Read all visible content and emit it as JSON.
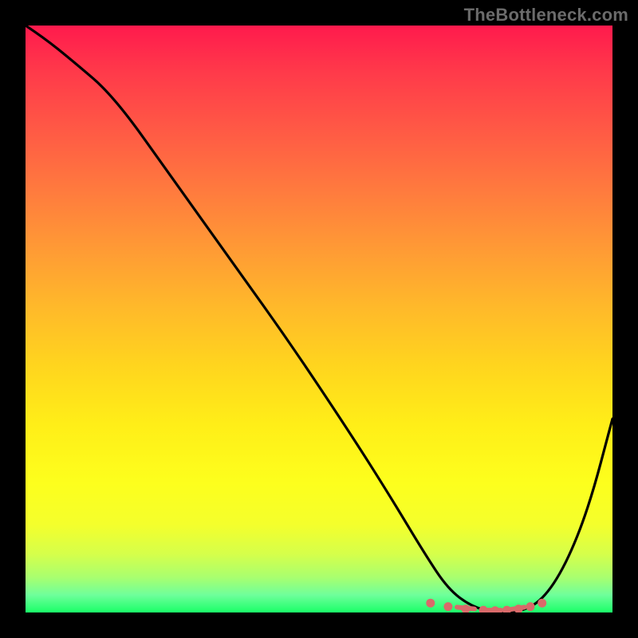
{
  "watermark": "TheBottleneck.com",
  "chart_data": {
    "type": "line",
    "title": "",
    "xlabel": "",
    "ylabel": "",
    "xlim": [
      0,
      100
    ],
    "ylim": [
      0,
      100
    ],
    "grid": false,
    "legend": false,
    "gradient_background": {
      "direction": "vertical",
      "stops": [
        {
          "pos": 0,
          "color": "#ff1a4d"
        },
        {
          "pos": 18,
          "color": "#ff5a45"
        },
        {
          "pos": 38,
          "color": "#ff9a35"
        },
        {
          "pos": 58,
          "color": "#ffd51e"
        },
        {
          "pos": 78,
          "color": "#fdff1d"
        },
        {
          "pos": 94,
          "color": "#a9ff6f"
        },
        {
          "pos": 100,
          "color": "#1aff68"
        }
      ]
    },
    "series": [
      {
        "name": "curve",
        "color": "#000000",
        "x": [
          0,
          3,
          8,
          15,
          25,
          35,
          45,
          55,
          62,
          68,
          72,
          76,
          80,
          84,
          88,
          92,
          96,
          100
        ],
        "values": [
          100,
          98,
          94,
          88,
          74,
          60,
          46,
          31,
          20,
          10,
          4,
          1,
          0,
          0,
          2,
          8,
          18,
          33
        ]
      }
    ],
    "trough_markers": {
      "color": "#d96a6a",
      "points": [
        {
          "x": 69,
          "y": 1.6
        },
        {
          "x": 72,
          "y": 1.0
        },
        {
          "x": 75,
          "y": 0.6
        },
        {
          "x": 78,
          "y": 0.4
        },
        {
          "x": 80,
          "y": 0.3
        },
        {
          "x": 82,
          "y": 0.4
        },
        {
          "x": 84,
          "y": 0.6
        },
        {
          "x": 86,
          "y": 1.0
        },
        {
          "x": 88,
          "y": 1.6
        }
      ],
      "dashes": [
        {
          "x1": 73.5,
          "y1": 0.9,
          "x2": 76.5,
          "y2": 0.6
        },
        {
          "x1": 78.0,
          "y1": 0.4,
          "x2": 81.0,
          "y2": 0.4
        },
        {
          "x1": 82.5,
          "y1": 0.5,
          "x2": 85.0,
          "y2": 0.9
        }
      ]
    }
  }
}
